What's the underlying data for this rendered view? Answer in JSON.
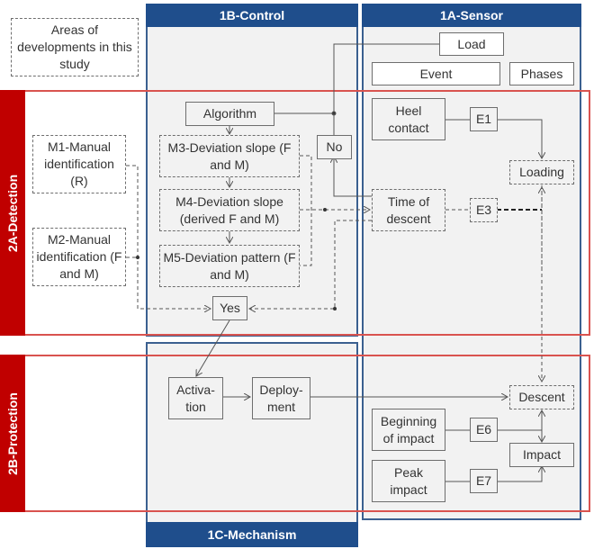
{
  "legend": {
    "text": "Areas of developments in this study"
  },
  "panels": {
    "control": "1B-Control",
    "sensor": "1A-Sensor",
    "mechanism": "1C-Mechanism"
  },
  "bands": {
    "detection": "2A-Detection",
    "protection": "2B-Protection"
  },
  "sensor_headers": {
    "load": "Load",
    "event": "Event",
    "phases": "Phases"
  },
  "control_nodes": {
    "algorithm": "Algorithm",
    "m3": "M3-Deviation slope (F and M)",
    "m4": "M4-Deviation slope (derived F and M)",
    "m5": "M5-Deviation pattern (F and M)",
    "no": "No",
    "yes": "Yes"
  },
  "manual_nodes": {
    "m1": "M1-Manual identification (R)",
    "m2": "M2-Manual identification (F and M)"
  },
  "sensor_nodes": {
    "heel_contact": "Heel contact",
    "e1": "E1",
    "loading": "Loading",
    "time_of_descent": "Time of descent",
    "e3": "E3",
    "descent": "Descent",
    "beginning_of_impact": "Beginning of impact",
    "e6": "E6",
    "impact": "Impact",
    "peak_impact": "Peak impact",
    "e7": "E7"
  },
  "mechanism_nodes": {
    "activation": "Activa- tion",
    "deployment": "Deploy- ment"
  }
}
